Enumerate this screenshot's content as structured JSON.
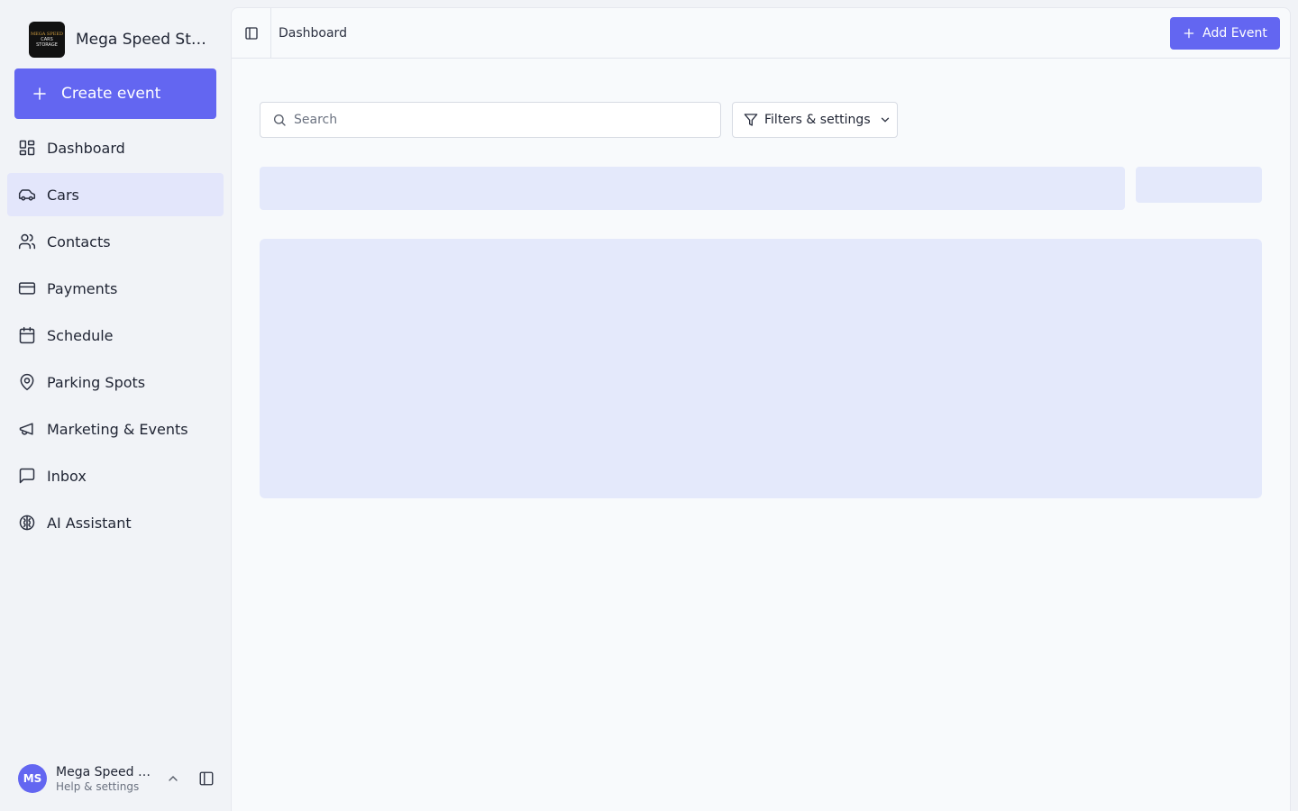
{
  "brand": {
    "name": "Mega Speed Storage",
    "logo_text": [
      "MEGA SPEED",
      "CARS",
      "STORAGE"
    ]
  },
  "sidebar": {
    "create_label": "Create event",
    "items": [
      {
        "label": "Dashboard",
        "icon": "dashboard-icon",
        "active": false
      },
      {
        "label": "Cars",
        "icon": "car-icon",
        "active": true
      },
      {
        "label": "Contacts",
        "icon": "users-icon",
        "active": false
      },
      {
        "label": "Payments",
        "icon": "credit-card-icon",
        "active": false
      },
      {
        "label": "Schedule",
        "icon": "calendar-icon",
        "active": false
      },
      {
        "label": "Parking Spots",
        "icon": "map-pin-icon",
        "active": false
      },
      {
        "label": "Marketing & Events",
        "icon": "megaphone-icon",
        "active": false
      },
      {
        "label": "Inbox",
        "icon": "message-square-icon",
        "active": false
      },
      {
        "label": "AI Assistant",
        "icon": "brain-icon",
        "active": false
      }
    ]
  },
  "user": {
    "initials": "MS",
    "name": "Mega Speed Storage",
    "subtitle": "Help & settings"
  },
  "header": {
    "breadcrumb": "Dashboard",
    "add_label": "Add Event"
  },
  "toolbar": {
    "search_placeholder": "Search",
    "search_value": "",
    "filters_label": "Filters & settings"
  },
  "colors": {
    "accent": "#6366f1",
    "active_nav": "#e3e6fb",
    "skeleton": "#e4e9fb"
  }
}
